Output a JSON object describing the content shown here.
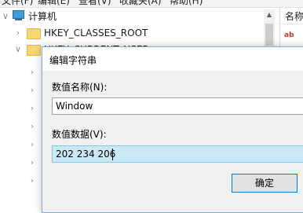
{
  "menu": {
    "items": [
      "文件(F)",
      "编辑(E)",
      "查看(V)",
      "收藏夹(A)",
      "帮助(H)"
    ]
  },
  "tree": {
    "root_label": "计算机",
    "items": [
      {
        "label": "HKEY_CLASSES_ROOT",
        "expanded": false
      },
      {
        "label": "HKEY_CURRENT_USER",
        "expanded": true
      }
    ]
  },
  "right_pane": {
    "header": "名称",
    "row_icon": "ab-icon"
  },
  "dialog": {
    "title": "编辑字符串",
    "name_label": "数值名称(N):",
    "name_value": "Window",
    "data_label": "数值数据(V):",
    "data_value": "202 234 206",
    "ok_label": "确定"
  }
}
